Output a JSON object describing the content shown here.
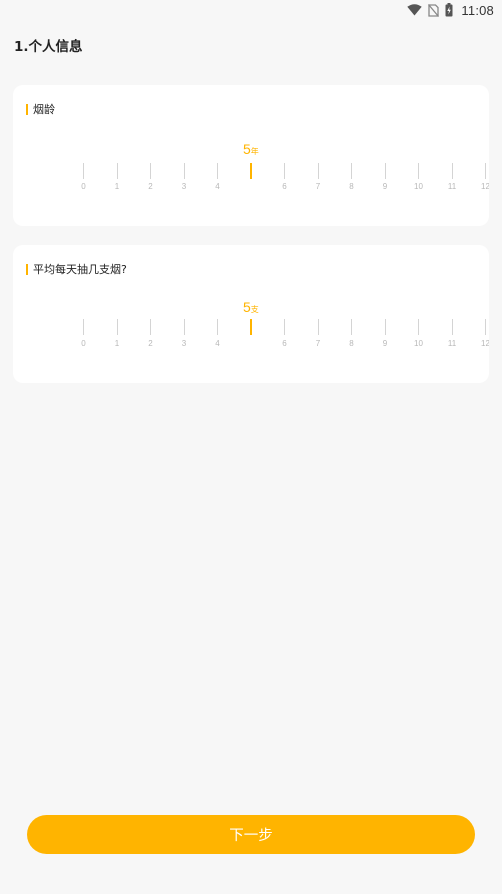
{
  "status_bar": {
    "time": "11:08",
    "icons": [
      "wifi-icon",
      "no-sim-icon",
      "battery-charging-icon"
    ]
  },
  "section_title": "1.个人信息",
  "cards": [
    {
      "label": "烟龄",
      "selected_value": "5",
      "unit": "年",
      "tick_labels": [
        "0",
        "1",
        "2",
        "3",
        "4",
        "6",
        "7",
        "8",
        "9",
        "10",
        "11",
        "12"
      ]
    },
    {
      "label": "平均每天抽几支烟?",
      "selected_value": "5",
      "unit": "支",
      "tick_labels": [
        "0",
        "1",
        "2",
        "3",
        "4",
        "6",
        "7",
        "8",
        "9",
        "10",
        "11",
        "12"
      ]
    }
  ],
  "next_button_label": "下一步",
  "colors": {
    "accent": "#ffb400",
    "background": "#f7f7f7",
    "card": "#ffffff",
    "tick": "#d4d4d4"
  }
}
